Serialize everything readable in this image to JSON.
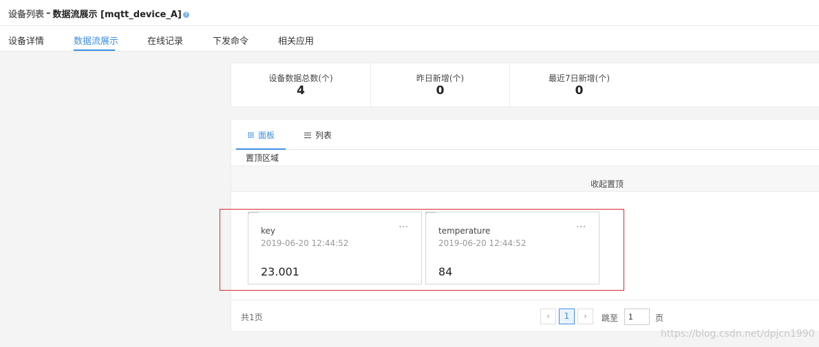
{
  "header": {
    "breadcrumb_parent": "设备列表",
    "breadcrumb_sep": "–",
    "breadcrumb_current": "数据流展示 [mqtt_device_A]",
    "help_icon": "help-circle-icon"
  },
  "tabs": [
    {
      "label": "设备详情"
    },
    {
      "label": "数据流展示",
      "active": true
    },
    {
      "label": "在线记录"
    },
    {
      "label": "下发命令"
    },
    {
      "label": "相关应用"
    }
  ],
  "stats": [
    {
      "label": "设备数据总数(个)",
      "value": "4"
    },
    {
      "label": "昨日新增(个)",
      "value": "0"
    },
    {
      "label": "最近7日新增(个)",
      "value": "0"
    }
  ],
  "view_tabs": [
    {
      "label": "面板",
      "icon": "grid-icon",
      "active": true
    },
    {
      "label": "列表",
      "icon": "list-icon"
    }
  ],
  "pinned": {
    "label": "置顶区域",
    "collapse_label": "收起置顶"
  },
  "cards": [
    {
      "key": "key",
      "time": "2019-06-20 12:44:52",
      "value": "23.001",
      "more": "···"
    },
    {
      "key": "temperature",
      "time": "2019-06-20 12:44:52",
      "value": "84",
      "more": "···"
    }
  ],
  "pagination": {
    "total_label": "共1页",
    "prev": "‹",
    "current_page": "1",
    "next": "›",
    "goto_label": "跳至",
    "goto_value": "1",
    "page_unit": "页"
  },
  "watermark": "https://blog.csdn.net/dpjcn1990",
  "colors": {
    "accent": "#3a8ee6",
    "highlight": "#d9262b"
  }
}
